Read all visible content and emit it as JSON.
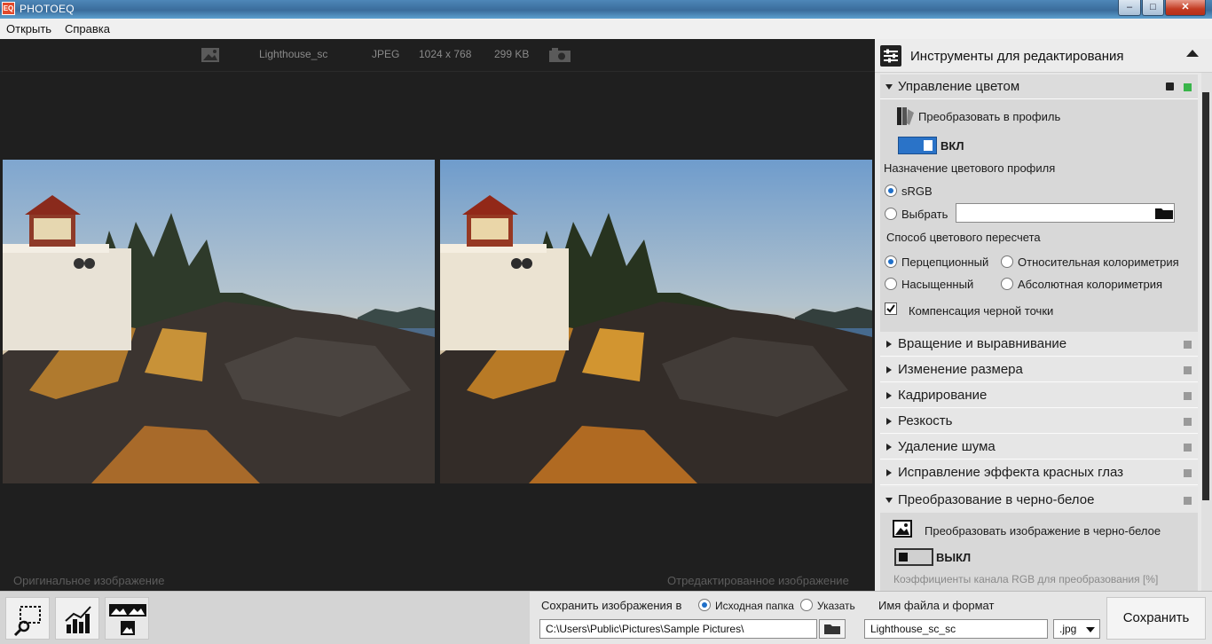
{
  "window": {
    "title": "PHOTOEQ",
    "logo_text": "EQ",
    "minimize": "–",
    "maximize": "□",
    "close": "✕"
  },
  "menu": {
    "open": "Открыть",
    "help": "Справка"
  },
  "image_info": {
    "name": "Lighthouse_sc",
    "format": "JPEG",
    "dimensions": "1024 x 768",
    "size": "299 KB"
  },
  "captions": {
    "original": "Оригинальное изображение",
    "edited": "Отредактированное изображение"
  },
  "panel": {
    "title": "Инструменты для редактирования",
    "color_management": {
      "label": "Управление цветом",
      "convert_label": "Преобразовать в профиль",
      "toggle_state": "ВКЛ",
      "destination_label": "Назначение цветового профиля",
      "option_srgb": "sRGB",
      "option_choose": "Выбрать",
      "choose_path": "",
      "intent_label": "Способ цветового пересчета",
      "intent_perceptual": "Перцепционный",
      "intent_relative": "Относительная колориметрия",
      "intent_saturation": "Насыщенный",
      "intent_absolute": "Абсолютная колориметрия",
      "black_point_label": "Компенсация черной точки",
      "black_point_checked": true,
      "selected_profile": "sRGB",
      "selected_intent": "Перцепционный"
    },
    "sections": [
      "Вращение и выравнивание",
      "Изменение размера",
      "Кадрирование",
      "Резкость",
      "Удаление шума",
      "Исправление эффекта красных глаз"
    ],
    "bw": {
      "label": "Преобразование в черно-белое",
      "convert_label": "Преобразовать изображение в черно-белое",
      "toggle_state": "ВЫКЛ",
      "coefficients_label": "Коэффициенты канала RGB для преобразования [%]"
    }
  },
  "save": {
    "save_to_label": "Сохранить изображения в",
    "source_folder": "Исходная папка",
    "specify": "Указать",
    "selected_target": "Исходная папка",
    "path": "C:\\Users\\Public\\Pictures\\Sample Pictures\\",
    "filename_label": "Имя файла и формат",
    "filename": "Lighthouse_sc_sc",
    "format": ".jpg",
    "save_button": "Сохранить"
  },
  "colors": {
    "accent": "#2a73c8",
    "active_indicator": "#39b54a",
    "viewer_bg": "#1f1f1f"
  }
}
